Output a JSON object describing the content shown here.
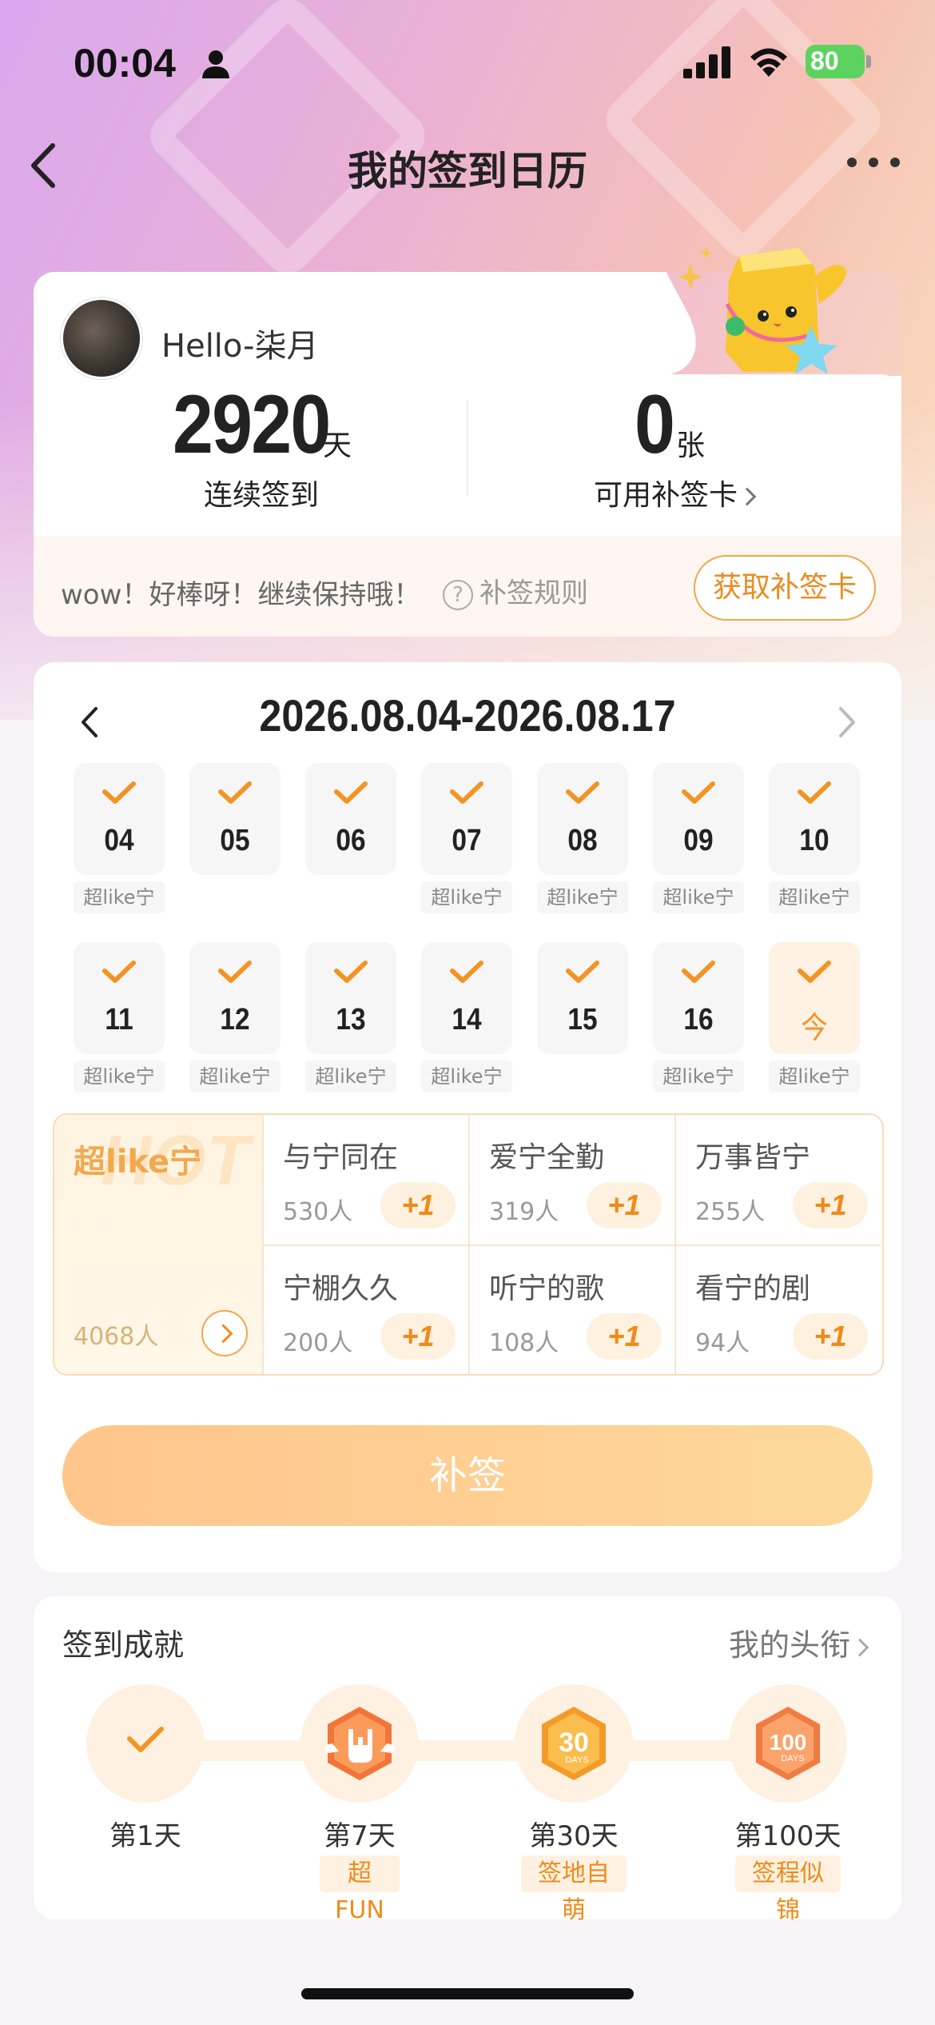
{
  "status_bar": {
    "time": "00:04",
    "battery": "80"
  },
  "nav": {
    "title": "我的签到日历"
  },
  "profile": {
    "username": "Hello-柒月",
    "streak_days": "2920",
    "streak_unit": "天",
    "streak_label": "连续签到",
    "cards": "0",
    "cards_unit": "张",
    "cards_label": "可用补签卡",
    "promo_text": "wow！好棒呀！继续保持哦！",
    "rules_label": "补签规则",
    "get_card_button": "获取补签卡"
  },
  "calendar": {
    "range": "2026.08.04-2026.08.17",
    "days": [
      {
        "num": "04",
        "tag": "超like宁",
        "checked": true
      },
      {
        "num": "05",
        "tag": "",
        "checked": true
      },
      {
        "num": "06",
        "tag": "",
        "checked": true
      },
      {
        "num": "07",
        "tag": "超like宁",
        "checked": true
      },
      {
        "num": "08",
        "tag": "超like宁",
        "checked": true
      },
      {
        "num": "09",
        "tag": "超like宁",
        "checked": true
      },
      {
        "num": "10",
        "tag": "超like宁",
        "checked": true
      },
      {
        "num": "11",
        "tag": "超like宁",
        "checked": true
      },
      {
        "num": "12",
        "tag": "超like宁",
        "checked": true
      },
      {
        "num": "13",
        "tag": "超like宁",
        "checked": true
      },
      {
        "num": "14",
        "tag": "超like宁",
        "checked": true
      },
      {
        "num": "15",
        "tag": "",
        "checked": true
      },
      {
        "num": "16",
        "tag": "超like宁",
        "checked": true
      },
      {
        "num": "今",
        "tag": "超like宁",
        "checked": true,
        "today": true
      }
    ],
    "topics": {
      "main": {
        "hot": "HOT",
        "name": "超like宁",
        "count": "4068人"
      },
      "items": [
        {
          "name": "与宁同在",
          "count": "530人",
          "plus": "+1"
        },
        {
          "name": "爱宁全勤",
          "count": "319人",
          "plus": "+1"
        },
        {
          "name": "万事皆宁",
          "count": "255人",
          "plus": "+1"
        },
        {
          "name": "宁棚久久",
          "count": "200人",
          "plus": "+1"
        },
        {
          "name": "听宁的歌",
          "count": "108人",
          "plus": "+1"
        },
        {
          "name": "看宁的剧",
          "count": "94人",
          "plus": "+1"
        }
      ]
    },
    "resign_button": "补签"
  },
  "achievements": {
    "title": "签到成就",
    "link": "我的头衔",
    "items": [
      {
        "day": "第1天",
        "tag": "",
        "icon": "check-icon"
      },
      {
        "day": "第7天",
        "tag": "超FUN",
        "icon": "rock-hand-badge-icon"
      },
      {
        "day": "第30天",
        "tag": "签地自萌",
        "icon": "30-days-badge-icon"
      },
      {
        "day": "第100天",
        "tag": "签程似锦",
        "icon": "100-days-badge-icon"
      }
    ]
  },
  "colors": {
    "accent": "#f08a18",
    "button": "#ffc787"
  }
}
